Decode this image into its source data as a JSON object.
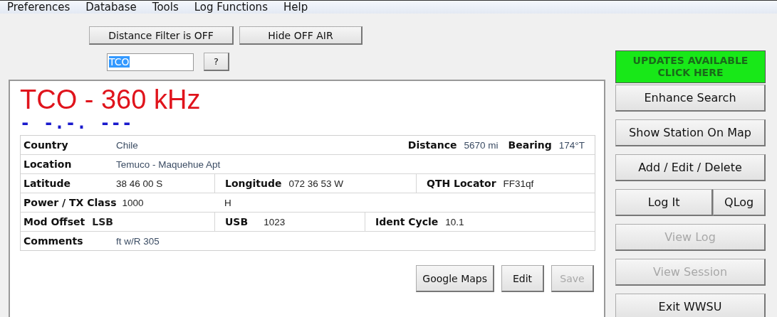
{
  "menu": [
    "Preferences",
    "Database",
    "Tools",
    "Log Functions",
    "Help"
  ],
  "filter_buttons": [
    {
      "label": "Distance Filter is OFF",
      "kind": "wide"
    },
    {
      "label": "Hide OFF AIR",
      "kind": "normal"
    }
  ],
  "search": {
    "value": "TCO",
    "value_selected": true,
    "help_button": "?"
  },
  "station": {
    "title": "TCO - 360 kHz",
    "morse": "- -.-. ---",
    "rows": [
      {
        "kind": "info",
        "fields": [
          {
            "label": "Country",
            "value": "Chile"
          },
          {
            "label": "Distance",
            "value": "5670 mi"
          },
          {
            "label": "Bearing",
            "value": "174°T"
          }
        ]
      },
      {
        "kind": "plain",
        "fields": [
          {
            "label": "Location",
            "value": "Temuco - Maquehue Apt"
          }
        ]
      },
      {
        "kind": "columns",
        "fields": [
          {
            "label": "Latitude",
            "value": "38 46 00 S"
          },
          {
            "label": "Longitude",
            "value": "072 36 53 W"
          },
          {
            "label": "QTH Locator",
            "value": "FF31qf"
          }
        ]
      },
      {
        "kind": "split",
        "fields": [
          {
            "label": "Power / TX Class",
            "value": "1000"
          },
          {
            "value": "H"
          }
        ]
      },
      {
        "kind": "columns-b",
        "fields": [
          {
            "label": "Mod Offset",
            "value": "LSB",
            "value_bold": true
          },
          {
            "label": "USB",
            "value": "1023"
          },
          {
            "label": "Ident Cycle",
            "value": "10.1"
          }
        ]
      },
      {
        "kind": "plain",
        "fields": [
          {
            "label": "Comments",
            "value": "ft w/R 305"
          }
        ]
      }
    ],
    "buttons": [
      {
        "label": "Google Maps",
        "disabled": false
      },
      {
        "label": "Edit",
        "disabled": false
      },
      {
        "label": "Save",
        "disabled": true
      }
    ]
  },
  "side_buttons": [
    {
      "label": "UPDATES AVAILABLE CLICK HERE",
      "kind": "alert",
      "disabled": false
    },
    {
      "label": "Enhance Search",
      "kind": "normal",
      "disabled": false
    },
    {
      "label": "Show Station On Map",
      "kind": "normal",
      "disabled": false
    },
    {
      "label": "Add / Edit / Delete",
      "kind": "normal",
      "disabled": false
    },
    {
      "label": "Log It",
      "kind": "half",
      "disabled": false
    },
    {
      "label": "QLog",
      "kind": "half",
      "disabled": false
    },
    {
      "label": "View Log",
      "kind": "normal",
      "disabled": true
    },
    {
      "label": "View Session",
      "kind": "normal",
      "disabled": true
    },
    {
      "label": "Exit WWSU",
      "kind": "normal",
      "disabled": false
    }
  ]
}
